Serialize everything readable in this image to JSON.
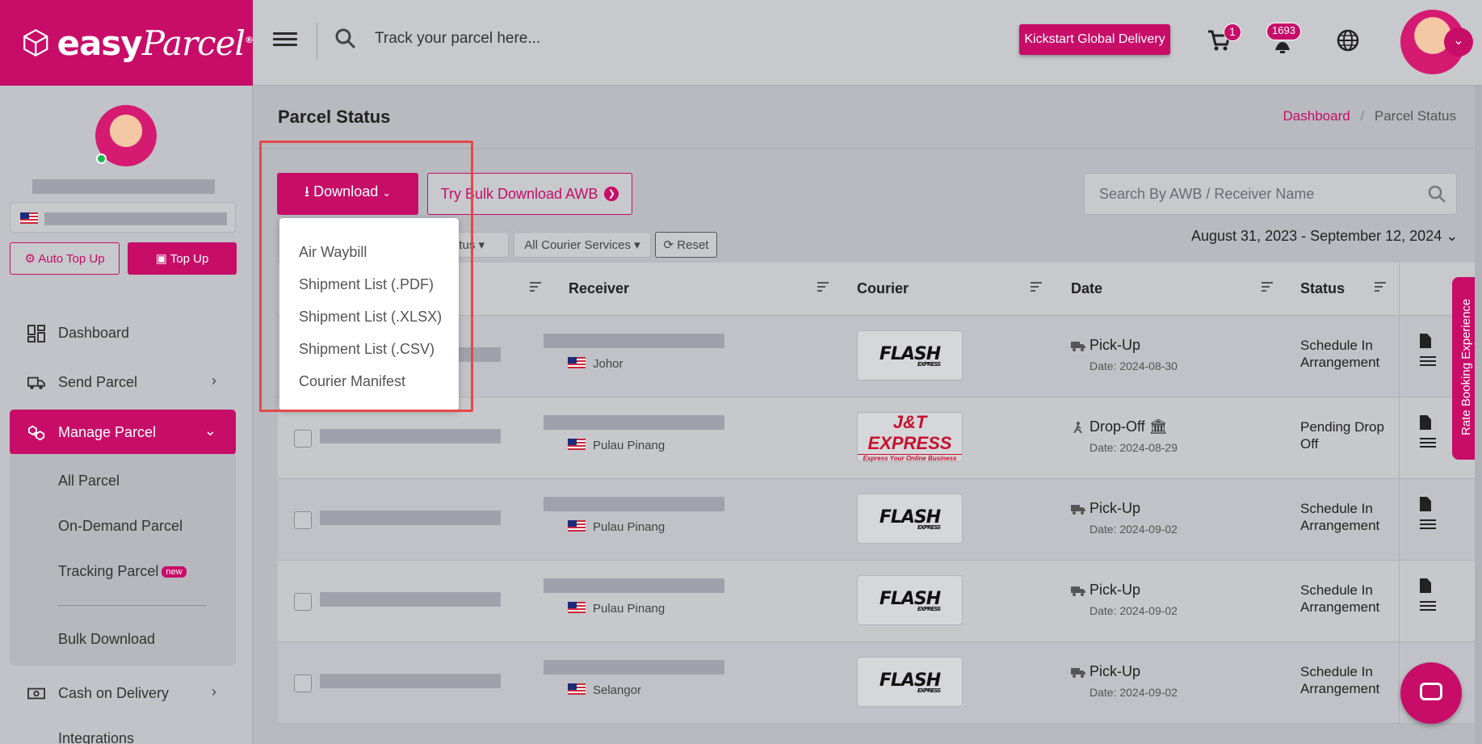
{
  "brand": {
    "name_bold": "easy",
    "name_script": "Parcel",
    "mark": "®"
  },
  "topbar": {
    "search_placeholder": "Track your parcel here...",
    "cta_label": "Kickstart Global Delivery",
    "cart_count": "1",
    "notif_count": "1693"
  },
  "sidebar": {
    "buttons": {
      "auto_topup": "Auto Top Up",
      "topup": "Top Up"
    },
    "items": [
      {
        "label": "Dashboard"
      },
      {
        "label": "Send Parcel"
      },
      {
        "label": "Manage Parcel"
      },
      {
        "label": "Cash on Delivery"
      },
      {
        "label": "Integrations"
      }
    ],
    "submenu": [
      {
        "label": "All Parcel"
      },
      {
        "label": "On-Demand Parcel"
      },
      {
        "label": "Tracking Parcel",
        "badge": "new"
      },
      {
        "label": "Bulk Download"
      }
    ]
  },
  "page": {
    "title": "Parcel Status",
    "breadcrumb": {
      "home": "Dashboard",
      "sep": "/",
      "current": "Parcel Status"
    }
  },
  "toolbar": {
    "download_label": "Download",
    "bulk_label": "Try Bulk Download AWB",
    "search_placeholder": "Search By AWB / Receiver Name",
    "filter_status_partial": "atus",
    "filter_courier": "All Courier Services",
    "reset_label": "Reset",
    "date_range": "August 31, 2023 - September 12, 2024"
  },
  "download_menu": [
    "Air Waybill",
    "Shipment List (.PDF)",
    "Shipment List (.XLSX)",
    "Shipment List (.CSV)",
    "Courier Manifest"
  ],
  "table": {
    "headers": {
      "receiver": "Receiver",
      "courier": "Courier",
      "date": "Date",
      "status": "Status"
    },
    "rows": [
      {
        "state": "Johor",
        "courier": "FLASH",
        "type": "Pick-Up",
        "date": "Date: 2024-08-30",
        "status": "Schedule In Arrangement"
      },
      {
        "state": "Pulau Pinang",
        "courier": "J&T",
        "type": "Drop-Off",
        "date": "Date: 2024-08-29",
        "status": "Pending Drop Off"
      },
      {
        "state": "Pulau Pinang",
        "courier": "FLASH",
        "type": "Pick-Up",
        "date": "Date: 2024-09-02",
        "status": "Schedule In Arrangement"
      },
      {
        "state": "Pulau Pinang",
        "courier": "FLASH",
        "type": "Pick-Up",
        "date": "Date: 2024-09-02",
        "status": "Schedule In Arrangement"
      },
      {
        "state": "Selangor",
        "courier": "FLASH",
        "type": "Pick-Up",
        "date": "Date: 2024-09-02",
        "status": "Schedule In Arrangement"
      }
    ],
    "courier_logos": {
      "flash_main": "FLASH",
      "flash_sub": "EXPRESS",
      "jt_main": "J&T EXPRESS",
      "jt_sub": "Express Your Online Business"
    }
  },
  "side_tab": "Rate Booking Experience",
  "colors": {
    "brand": "#c70d68",
    "highlight": "#e54848"
  }
}
